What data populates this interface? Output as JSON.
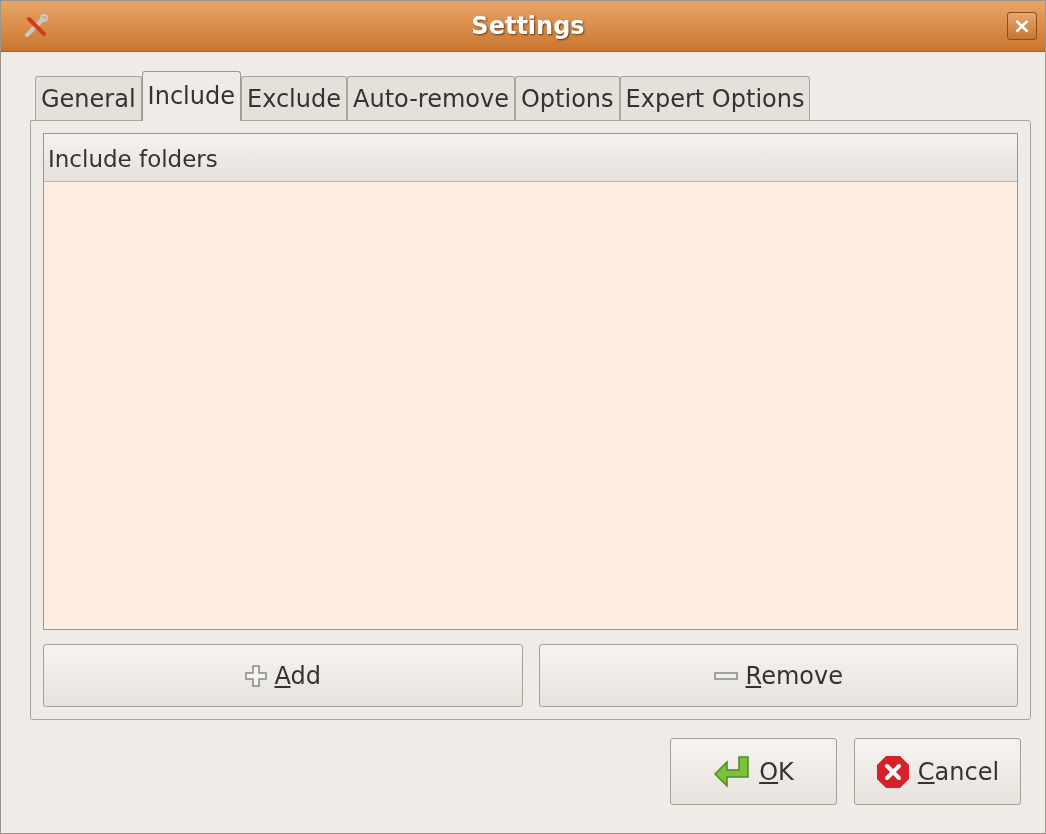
{
  "window": {
    "title": "Settings",
    "close": "×"
  },
  "tabs": [
    {
      "label": "General",
      "selected": false
    },
    {
      "label": "Include",
      "selected": true
    },
    {
      "label": "Exclude",
      "selected": false
    },
    {
      "label": "Auto-remove",
      "selected": false
    },
    {
      "label": "Options",
      "selected": false
    },
    {
      "label": "Expert Options",
      "selected": false
    }
  ],
  "list": {
    "column": "Include folders"
  },
  "list_buttons": [
    {
      "kind": "add",
      "label": "Add",
      "underline_first": true
    },
    {
      "kind": "remove",
      "label": "Remove",
      "underline_first": true
    }
  ],
  "dialog_buttons": [
    {
      "kind": "ok",
      "label": "OK",
      "underline_first": true
    },
    {
      "kind": "cancel",
      "label": "Cancel",
      "underline_first": true
    }
  ]
}
